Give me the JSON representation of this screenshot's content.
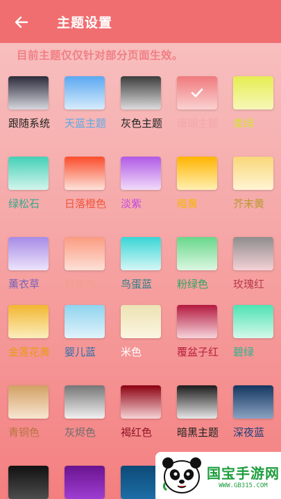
{
  "header": {
    "back_icon": "arrow-left-icon",
    "title": "主题设置"
  },
  "hint": "目前主题仅仅针对部分页面生效。",
  "themes": [
    {
      "label": "跟随系统",
      "color": "#222222",
      "top": "#2b2b3a",
      "bottom": "#d7d7df"
    },
    {
      "label": "天蓝主题",
      "color": "#5aa9e6",
      "top": "#5ba8f2",
      "bottom": "#d7ecfb"
    },
    {
      "label": "灰色主题",
      "color": "#222222",
      "top": "#3d3d3d",
      "bottom": "#dcdcdc"
    },
    {
      "label": "珊瑚主题",
      "color": "#f3a7a9",
      "top": "#f07a7d",
      "bottom": "#fbd1d1",
      "selected": true
    },
    {
      "label": "柔绿",
      "color": "#d5e23a",
      "top": "#e5ee52",
      "bottom": "#f7f7b8"
    },
    {
      "label": "绿松石",
      "color": "#3aa78d",
      "top": "#44d0b6",
      "bottom": "#d3f5ed"
    },
    {
      "label": "日落橙色",
      "color": "#f0553b",
      "top": "#fb4c2b",
      "bottom": "#fde2da"
    },
    {
      "label": "淡紫",
      "color": "#c048e2",
      "top": "#b05ae6",
      "bottom": "#f1dbfa"
    },
    {
      "label": "暗黄",
      "color": "#f5b800",
      "top": "#ffb400",
      "bottom": "#fff0b3"
    },
    {
      "label": "芥末黄",
      "color": "#b89a2e",
      "top": "#f9d77a",
      "bottom": "#fff4d4"
    },
    {
      "label": "薰衣草",
      "color": "#7a63b8",
      "top": "#a78be6",
      "bottom": "#ece4fb"
    },
    {
      "label": "鲑鱼色",
      "color": "#f2a08d",
      "top": "#fb9b81",
      "bottom": "#fde0d6"
    },
    {
      "label": "鸟蛋蓝",
      "color": "#2e7f86",
      "top": "#39d6d6",
      "bottom": "#d6f6f6"
    },
    {
      "label": "粉绿色",
      "color": "#2fa563",
      "top": "#68d78a",
      "bottom": "#dcf7e2"
    },
    {
      "label": "玫瑰红",
      "color": "#b83a4a",
      "top": "#8f8d8e",
      "bottom": "#f4d2d6"
    },
    {
      "label": "金莲花黄",
      "color": "#e89b14",
      "top": "#f2b632",
      "bottom": "#fbeebd"
    },
    {
      "label": "婴儿蓝",
      "color": "#2d6ea8",
      "top": "#8fd3ee",
      "bottom": "#e1f3fb"
    },
    {
      "label": "米色",
      "color": "#ffffff",
      "top": "#ede2b3",
      "bottom": "#fbf6e2"
    },
    {
      "label": "覆盆子红",
      "color": "#b8213f",
      "top": "#b3193f",
      "bottom": "#f7d3db"
    },
    {
      "label": "碧绿",
      "color": "#2ab48b",
      "top": "#4ee3b3",
      "bottom": "#d5f8ea"
    },
    {
      "label": "青铜色",
      "color": "#b7743f",
      "top": "#d2a063",
      "bottom": "#f8e6d2"
    },
    {
      "label": "灰烬色",
      "color": "#6d6d6d",
      "top": "#767676",
      "bottom": "#f1f1f1"
    },
    {
      "label": "褐红色",
      "color": "#8e1424",
      "top": "#8c0010",
      "bottom": "#f7d3d6"
    },
    {
      "label": "暗黑主题",
      "color": "#222222",
      "top": "#1b1b1b",
      "bottom": "#e6e6e6"
    },
    {
      "label": "深夜蓝",
      "color": "#1f3f7a",
      "top": "#14365f",
      "bottom": "#8aa2c2"
    },
    {
      "label": "",
      "color": "#222222",
      "top": "#111111",
      "bottom": "#4d4d4d"
    },
    {
      "label": "",
      "color": "#222222",
      "top": "#6a1490",
      "bottom": "#9e3ed2"
    },
    {
      "label": "",
      "color": "#222222",
      "top": "#0d4a78",
      "bottom": "#1d6ea6"
    }
  ],
  "watermark": {
    "main": "国宝手游网",
    "sub": "WWW.GB315.COM",
    "logo_icon": "panda-icon"
  }
}
